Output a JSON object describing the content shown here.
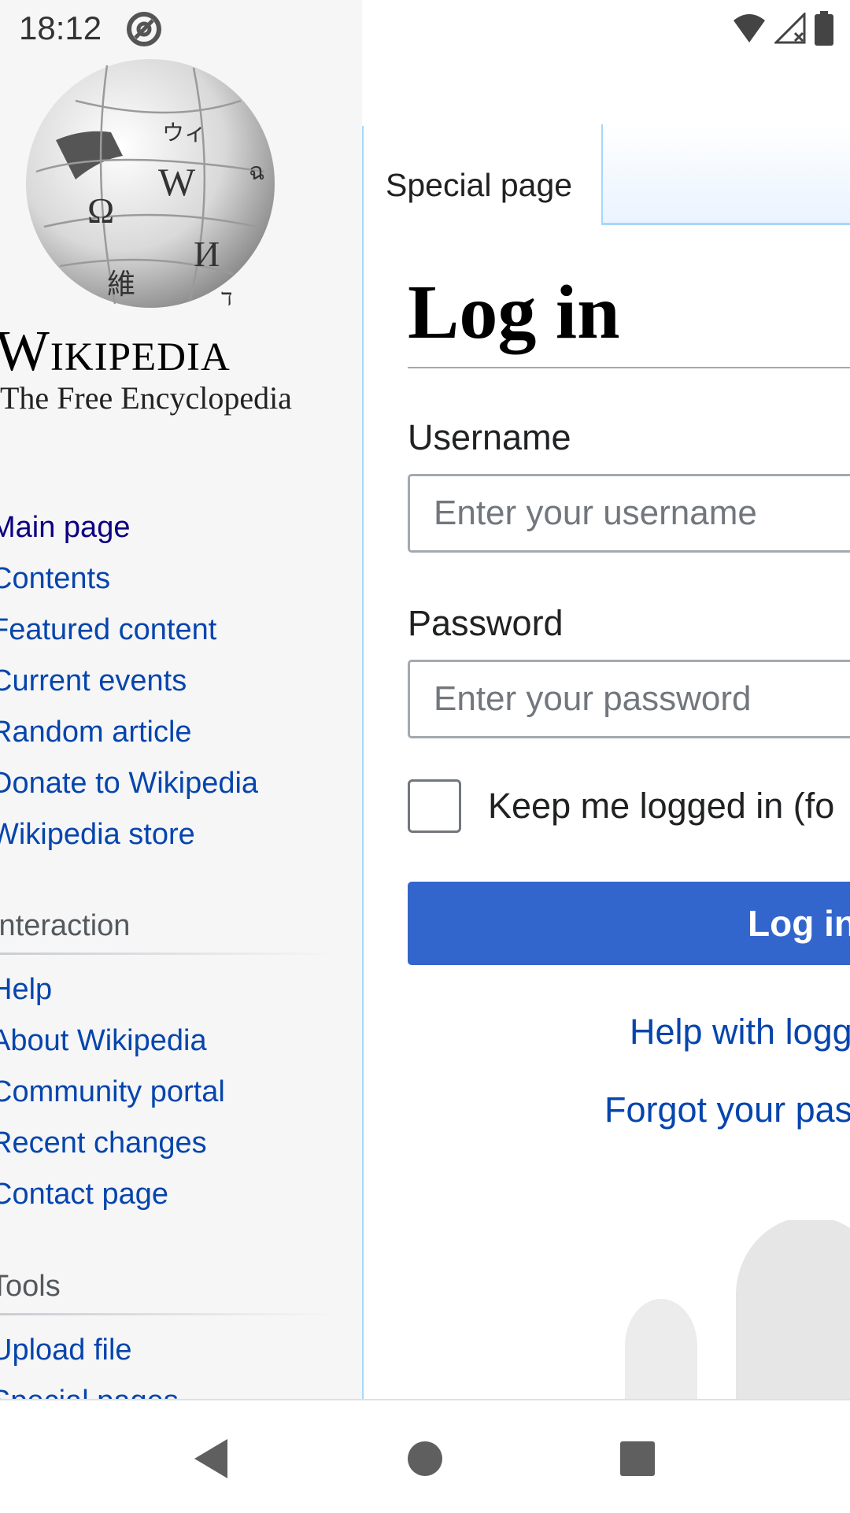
{
  "status_bar": {
    "time": "18:12",
    "app_icon": "at-sign-notification-icon",
    "icons": [
      "wifi-icon",
      "cellular-signal-icon",
      "battery-icon"
    ]
  },
  "logo": {
    "icon": "wikipedia-globe-logo",
    "wordmark": "Wikipedia",
    "tagline": "The Free Encyclopedia"
  },
  "sidebar": {
    "navigation": [
      {
        "label": "Main page"
      },
      {
        "label": "Contents"
      },
      {
        "label": "Featured content"
      },
      {
        "label": "Current events"
      },
      {
        "label": "Random article"
      },
      {
        "label": "Donate to Wikipedia"
      },
      {
        "label": "Wikipedia store"
      }
    ],
    "interaction": {
      "heading": "Interaction",
      "items": [
        {
          "label": "Help"
        },
        {
          "label": "About Wikipedia"
        },
        {
          "label": "Community portal"
        },
        {
          "label": "Recent changes"
        },
        {
          "label": "Contact page"
        }
      ]
    },
    "tools": {
      "heading": "Tools",
      "items": [
        {
          "label": "Upload file"
        },
        {
          "label": "Special pages"
        }
      ]
    }
  },
  "tabs": {
    "special_page": "Special page"
  },
  "main": {
    "title": "Log in",
    "username_label": "Username",
    "username_placeholder": "Enter your username",
    "password_label": "Password",
    "password_placeholder": "Enter your password",
    "keep_logged_in": "Keep me logged in (fo",
    "login_button": "Log in",
    "help_link": "Help with logg",
    "forgot_link": "Forgot your pas"
  },
  "colors": {
    "link": "#0645ad",
    "visited_link": "#0b0080",
    "button": "#3366cc",
    "sidebar_bg": "#f6f6f6",
    "tab_border": "#a7d7f9"
  },
  "android_nav": {
    "back_icon": "back-triangle-icon",
    "home_icon": "home-circle-icon",
    "recents_icon": "recents-square-icon"
  }
}
